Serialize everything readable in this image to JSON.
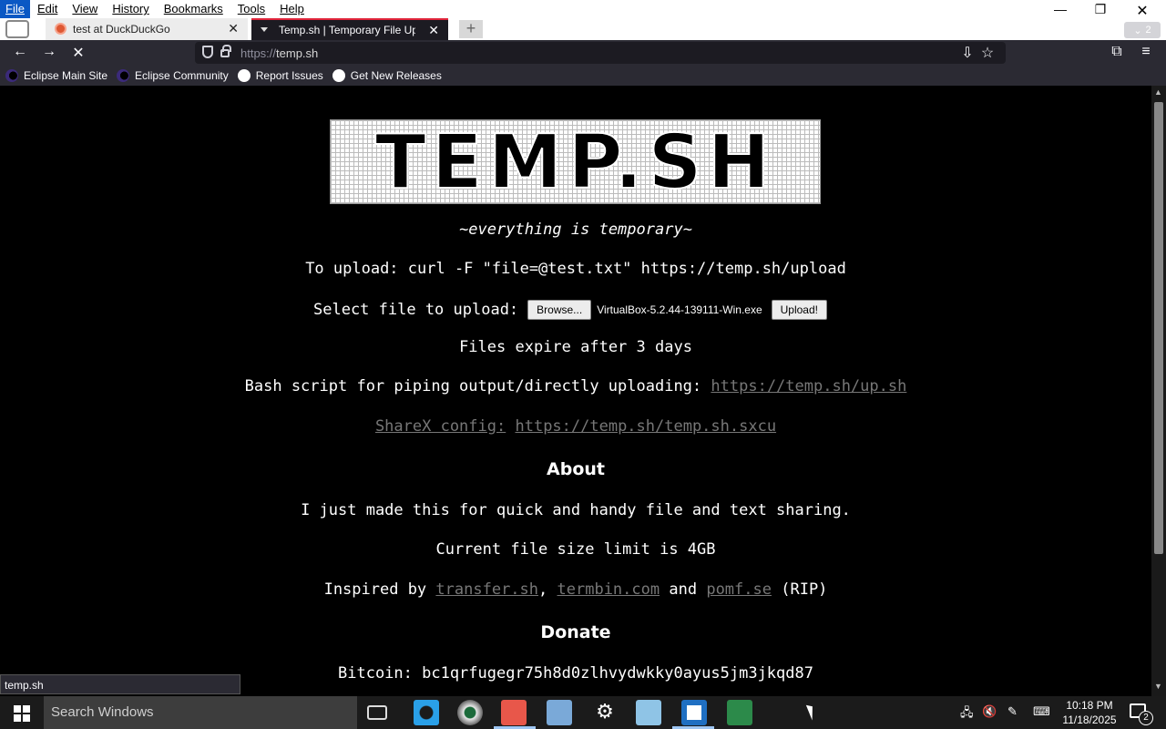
{
  "menubar": {
    "items": [
      "File",
      "Edit",
      "View",
      "History",
      "Bookmarks",
      "Tools",
      "Help"
    ]
  },
  "tabs": [
    {
      "title": "test at DuckDuckGo"
    },
    {
      "title": "Temp.sh | Temporary File Uploa"
    }
  ],
  "tabs_count": "2",
  "navbar": {
    "url_prefix": "https://",
    "url_host": "temp.sh"
  },
  "bookmarks": [
    {
      "label": "Eclipse Main Site",
      "icon": "eclipse-icon"
    },
    {
      "label": "Eclipse Community",
      "icon": "eclipse-icon"
    },
    {
      "label": "Report Issues",
      "icon": "github-icon"
    },
    {
      "label": "Get New Releases",
      "icon": "github-icon"
    }
  ],
  "page": {
    "logo_text": "TEMP.SH",
    "tagline": "~everything is temporary~",
    "upload_cmd": "To upload: curl -F \"file=@test.txt\" https://temp.sh/upload",
    "select_label": "Select file to upload:",
    "browse_label": "Browse...",
    "file_name": "VirtualBox-5.2.44-139111-Win.exe",
    "upload_label": "Upload!",
    "expire": "Files expire after 3 days",
    "bash_label": "Bash script for piping output/directly uploading:",
    "bash_link": "https://temp.sh/up.sh",
    "sharex_label": "ShareX config:",
    "sharex_link": "https://temp.sh/temp.sh.sxcu",
    "about_heading": "About",
    "about_text": "I just made this for quick and handy file and text sharing.",
    "limit_text": "Current file size limit is 4GB",
    "inspired_prefix": "Inspired by",
    "inspired_links": [
      "transfer.sh",
      "termbin.com",
      "pomf.se"
    ],
    "inspired_sep": ",",
    "inspired_and": "and",
    "inspired_suffix": "(RIP)",
    "donate_heading": "Donate",
    "bitcoin": "Bitcoin: bc1qrfugegr75h8d0zlhvydwkky0ayus5jm3jkqd87"
  },
  "status_text": "temp.sh",
  "taskbar": {
    "search_placeholder": "Search Windows",
    "time": "10:18 PM",
    "date": "11/18/2025",
    "notification_count": "2"
  }
}
